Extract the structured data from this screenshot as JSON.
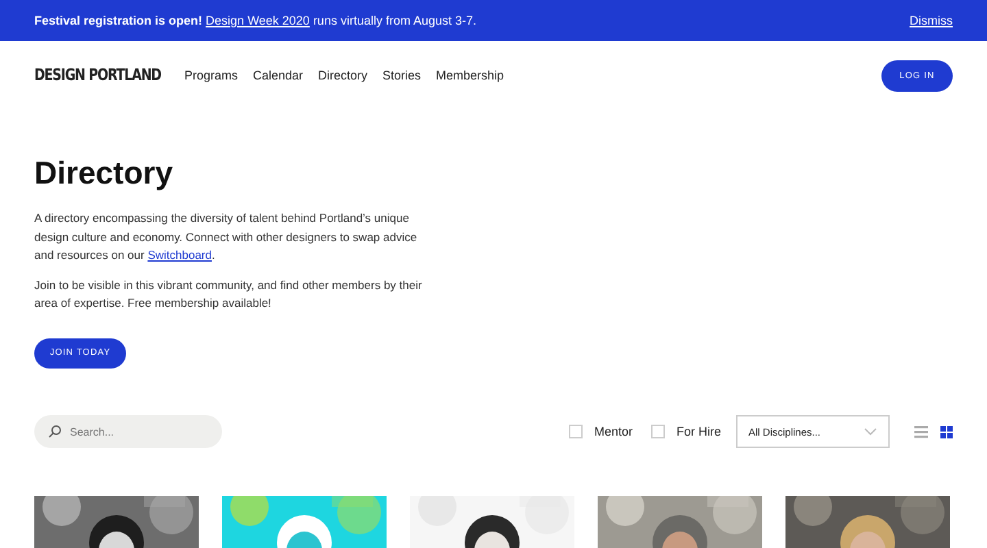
{
  "banner": {
    "lead": "Festival registration is open!",
    "link": "Design Week 2020",
    "rest": "runs virtually from August 3-7.",
    "dismiss": "Dismiss"
  },
  "header": {
    "logo": "DESIGN PORTLAND",
    "nav": [
      "Programs",
      "Calendar",
      "Directory",
      "Stories",
      "Membership"
    ],
    "login": "LOG IN"
  },
  "intro": {
    "title": "Directory",
    "para1": "A directory encompassing the diversity of talent behind Portland’s unique design culture and economy. Connect with other designers to swap advice and resources on our",
    "para1_link": "Switchboard",
    "para1_end": ".",
    "para2": "Join to be visible in this vibrant community, and find other members by their area of expertise. Free membership available!",
    "cta": "JOIN TODAY"
  },
  "filters": {
    "search": {
      "placeholder": "Search..."
    },
    "checkboxes": [
      {
        "label": "Mentor",
        "checked": false
      },
      {
        "label": "For Hire",
        "checked": false
      }
    ],
    "discipline": "All Disciplines...",
    "views": [
      {
        "kind": "list",
        "selected": false
      },
      {
        "kind": "grid",
        "selected": true
      }
    ]
  }
}
